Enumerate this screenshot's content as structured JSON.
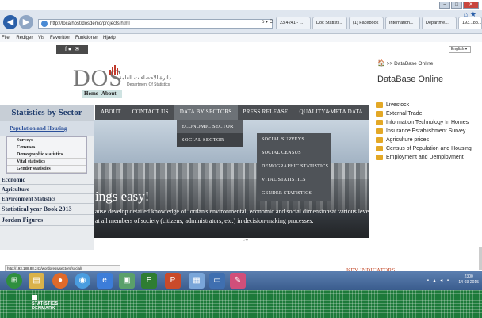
{
  "browser": {
    "url": "http://localhost/dosdemo/projects.html",
    "search_hint": "ρ ▾ C",
    "tabs": [
      {
        "label": "23.4241 - ..."
      },
      {
        "label": "Doc Statisti..."
      },
      {
        "label": "(1) Facebook"
      },
      {
        "label": "Internation..."
      },
      {
        "label": "Departme..."
      },
      {
        "label": "193.188..."
      }
    ],
    "menu": [
      "Filer",
      "Rediger",
      "Vis",
      "Favoritter",
      "Funktioner",
      "Hjælp"
    ]
  },
  "site": {
    "social_label": "f ☛ ✉",
    "language": "English",
    "logo_text": "DOS",
    "logo_arabic": "دائرة الاحصاءات العامة",
    "logo_subtitle": "Department Of Statistics",
    "home_link": "Home",
    "about_link": "About"
  },
  "sidebar": {
    "title": "Statistics by Sector",
    "section": "Population and Housing",
    "sub_items": [
      "Surveys",
      "Censuses",
      "Demographic statistics",
      "Vital statistics",
      "Gender statistics"
    ],
    "items": [
      "Economic",
      "Agriculture",
      "Environment Statistics",
      "Statistical year Book 2013",
      "Jordan Figures"
    ]
  },
  "nav": {
    "items": [
      "ABOUT",
      "CONTACT US",
      "DATA BY SECTORS",
      "PRESS RELEASE",
      "QUALITY&META DATA"
    ],
    "dropdown1": [
      "ECONOMIC SECTOR",
      "SOCIAL SECTOR"
    ],
    "dropdown2": [
      "SOCIAL SURVEYS",
      "SOCIAL CENSUS",
      "DEMOGRAPHIC STATISTICS",
      "VITAL STATISTICS",
      "GENDER STATISTICS"
    ]
  },
  "hero": {
    "title": "ings easy!",
    "line1": "ause develop detailed knowledge of Jordan's environmental, economic and social dimensionsat various levels of",
    "line2": "at all members of society (citizens, administrators, etc.) in decision-making processes."
  },
  "right_panel": {
    "breadcrumb": ">> DataBase Online",
    "title": "DataBase Online",
    "items": [
      "Livestock",
      "External Trade",
      "Information Technology In Homes",
      "Insurance Establishment Survey",
      "Agriculture prices",
      "Census of Population and Housing",
      "Employment and Uemployment"
    ]
  },
  "status_url": "http://193.188.88.243/wordpress/sectors/social/",
  "key_indicators": "KEY INDICATORS",
  "taskbar": {
    "time": "2300",
    "date": "14-03-2015"
  },
  "banner": {
    "line1": "STATISTICS",
    "line2": "DENMARK"
  }
}
